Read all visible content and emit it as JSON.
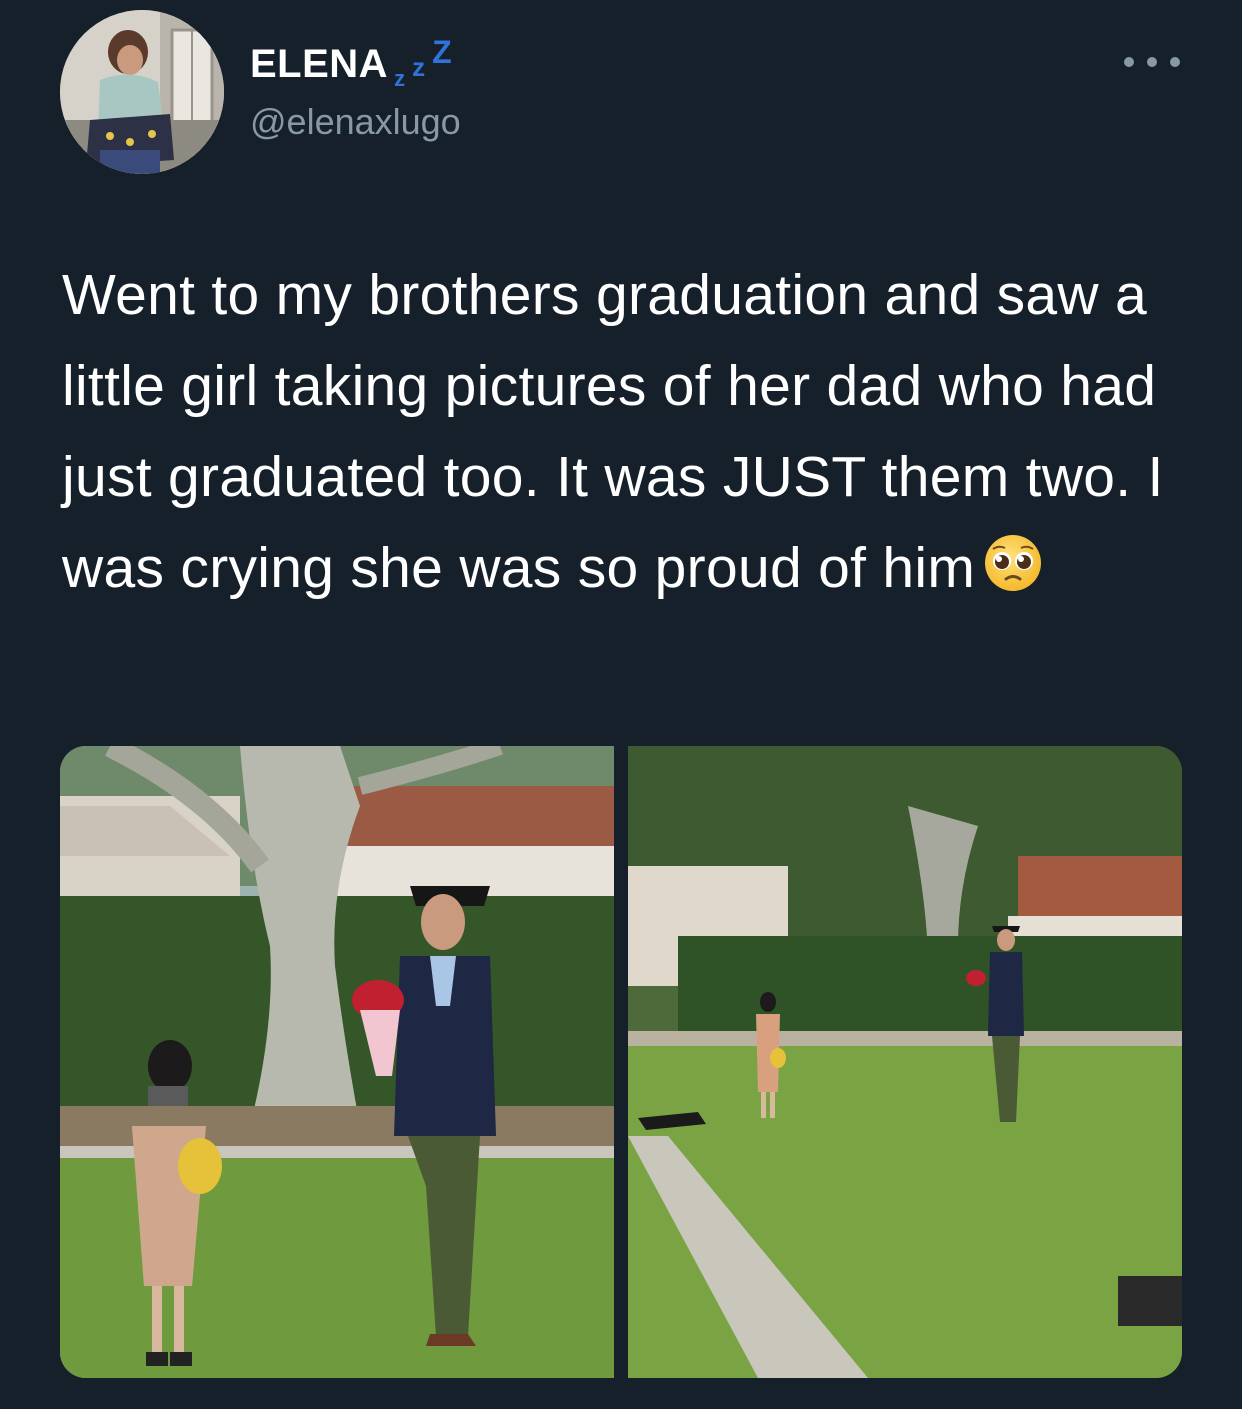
{
  "author": {
    "display_name": "ELENA",
    "name_emoji": [
      "z",
      "z",
      "Z"
    ],
    "handle": "@elenaxlugo",
    "avatar_icon": "profile-photo"
  },
  "tweet": {
    "text": "Went to my brothers graduation and saw a little girl taking pictures of her dad who had just graduated too. It was JUST them two. I was crying she was so proud of him",
    "emoji": "pleading-face-icon"
  },
  "menu": {
    "icon": "more-options-icon"
  },
  "media": {
    "count": 2,
    "photos": [
      "photo-1",
      "photo-2"
    ]
  },
  "colors": {
    "background": "#15202b",
    "text_primary": "#ffffff",
    "text_secondary": "#8899a6",
    "zzz_blue": "#2f73d9"
  }
}
